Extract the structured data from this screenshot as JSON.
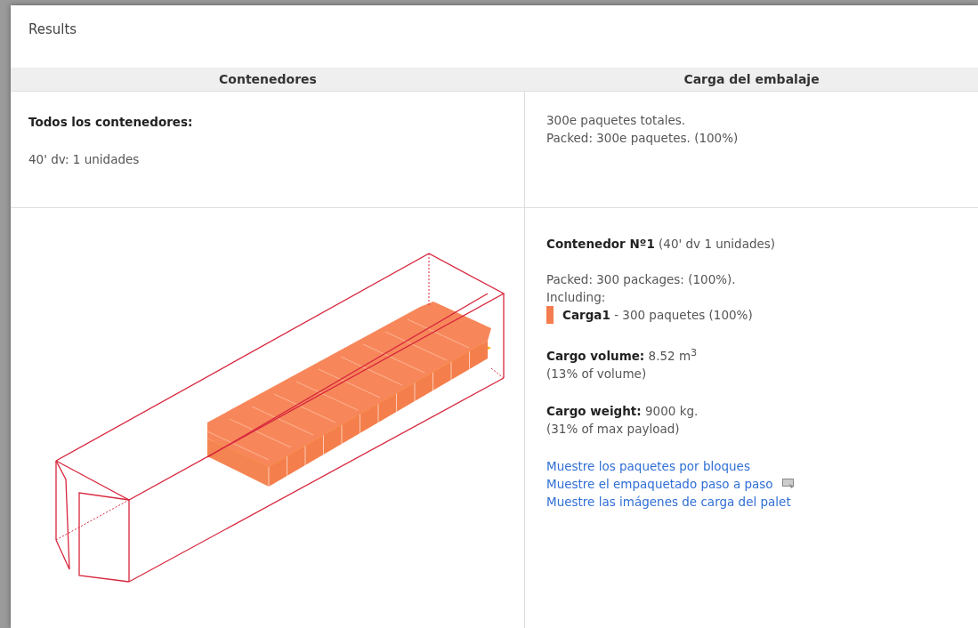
{
  "panel": {
    "title": "Results"
  },
  "columns": [
    "Contenedores",
    "Carga del embalaje"
  ],
  "summary": {
    "heading": "Todos los contenedores:",
    "units": "40' dv: 1 unidades",
    "lines": [
      "300e paquetes totales.",
      "Packed: 300e paquetes. (100%)"
    ]
  },
  "container": {
    "name": "Contenedor Nº1",
    "detail": "(40' dv 1 unidades)",
    "packed": "Packed: 300 packages: (100%).",
    "including": "Including:",
    "cargo": [
      {
        "name": "Carga1",
        "detail": "- 300 paquetes (100%)",
        "color": "#f47c4e"
      }
    ],
    "volume": {
      "label": "Cargo volume:",
      "value": "8.52 m$^{3}$",
      "share": "(13% of volume)"
    },
    "weight": {
      "label": "Cargo weight:",
      "value": "9000 kg.",
      "share": "(31% of max payload)"
    },
    "links": [
      {
        "label": "Muestre los paquetes por bloques",
        "kind": "plain"
      },
      {
        "label": "Muestre el empaquetado paso a paso",
        "kind": "video"
      },
      {
        "label": "Muestre las imágenes de carga del palet",
        "kind": "plain"
      }
    ]
  }
}
